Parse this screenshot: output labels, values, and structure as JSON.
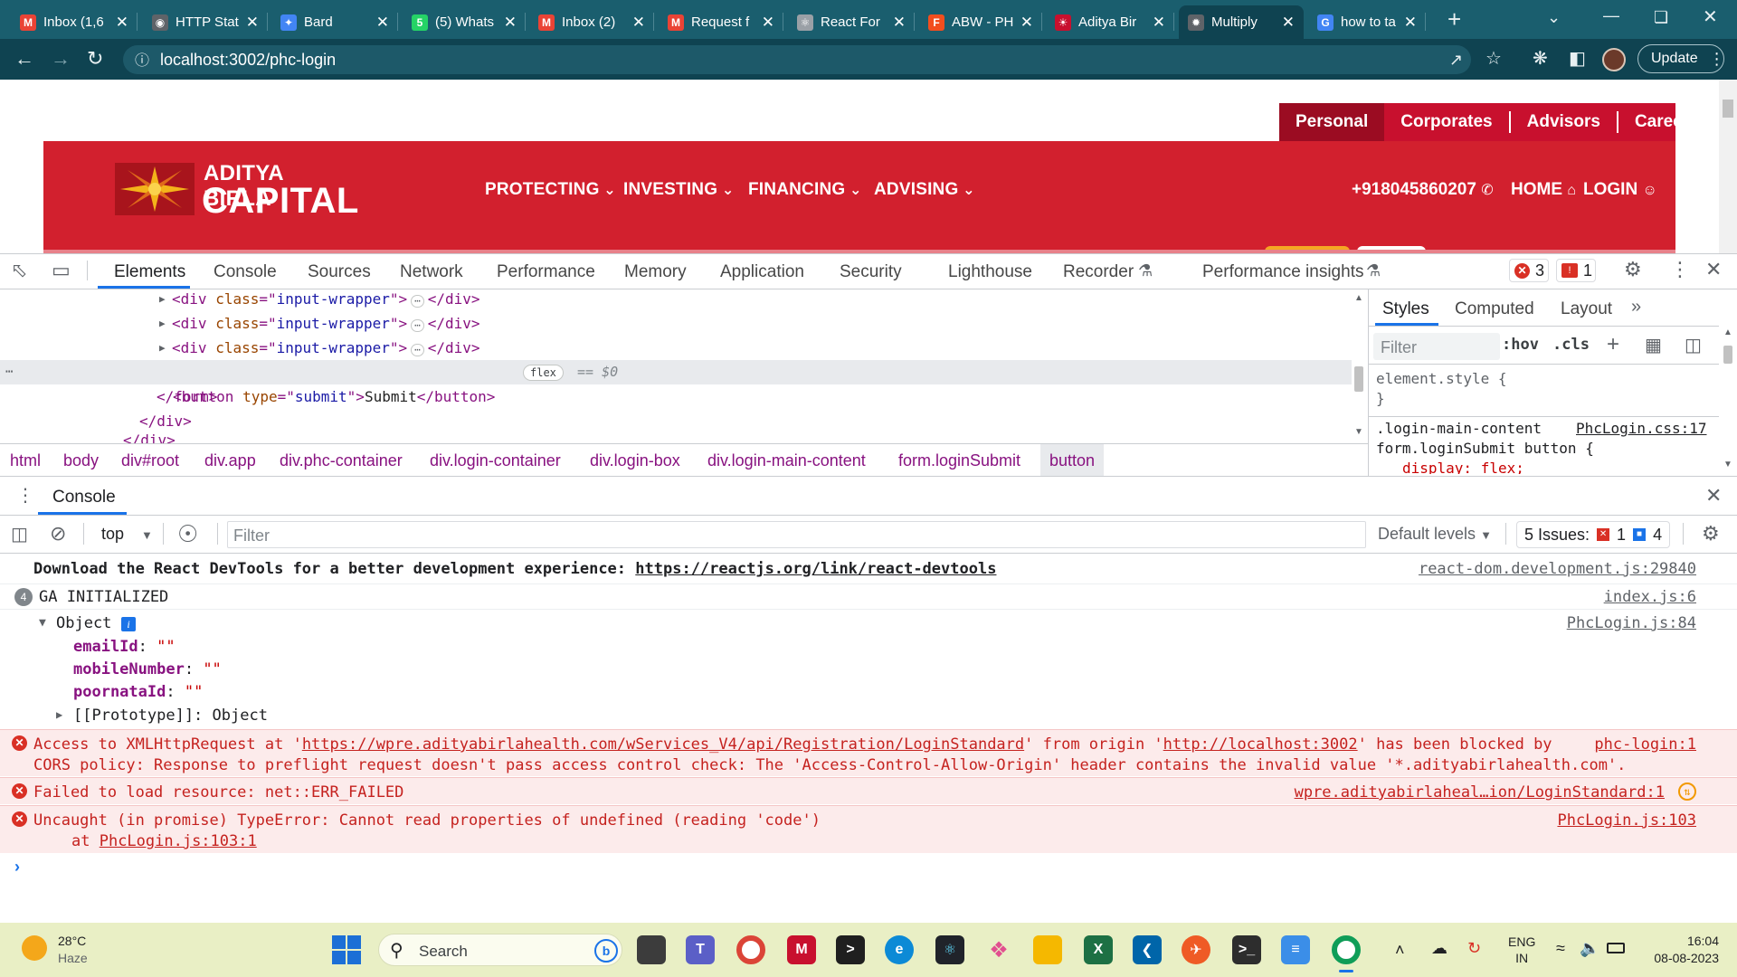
{
  "browser": {
    "tabs": [
      {
        "title": "Inbox (1,6",
        "icon": "gmail-icon"
      },
      {
        "title": "HTTP Stat",
        "icon": "globe-icon"
      },
      {
        "title": "Bard",
        "icon": "bard-icon"
      },
      {
        "title": "(5) Whats",
        "icon": "whatsapp-icon"
      },
      {
        "title": "Inbox (2)",
        "icon": "gmail-icon"
      },
      {
        "title": "Request f",
        "icon": "gmail-icon"
      },
      {
        "title": "React For",
        "icon": "react-icon"
      },
      {
        "title": "ABW - PH",
        "icon": "figma-icon"
      },
      {
        "title": "Aditya Bir",
        "icon": "aditya-birla-icon"
      },
      {
        "title": "Multiply",
        "icon": "openai-icon",
        "active": true
      },
      {
        "title": "how to ta",
        "icon": "google-icon"
      }
    ],
    "url": "localhost:3002/phc-login",
    "update_label": "Update"
  },
  "site": {
    "top_nav": [
      "Personal",
      "Corporates",
      "Advisors",
      "Careers"
    ],
    "logo_line1": "ADITYA BIRLA",
    "logo_line2": "CAPITAL",
    "main_nav": [
      "PROTECTING",
      "INVESTING",
      "FINANCING",
      "ADVISING"
    ],
    "phone": "+918045860207",
    "home": "HOME",
    "login": "LOGIN"
  },
  "devtools": {
    "tabs": [
      "Elements",
      "Console",
      "Sources",
      "Network",
      "Performance",
      "Memory",
      "Application",
      "Security",
      "Lighthouse",
      "Recorder",
      "Performance insights"
    ],
    "error_count": "3",
    "issue_count": "1",
    "elements": {
      "lines": [
        {
          "indent": 0,
          "tag": "div",
          "attr": "class",
          "val": "input-wrapper"
        },
        {
          "indent": 0,
          "tag": "div",
          "attr": "class",
          "val": "input-wrapper"
        },
        {
          "indent": 0,
          "tag": "div",
          "attr": "class",
          "val": "input-wrapper"
        }
      ],
      "selected_tag": "button",
      "selected_attr": "type",
      "selected_val": "submit",
      "selected_text": "Submit",
      "flex_badge": "flex",
      "dollar_zero": "== $0",
      "close_form": "</form>",
      "close_div": "</div>",
      "close_div2": "</div>"
    },
    "breadcrumbs": [
      "html",
      "body",
      "div#root",
      "div.app",
      "div.phc-container",
      "div.login-container",
      "div.login-box",
      "div.login-main-content",
      "form.loginSubmit",
      "button"
    ],
    "styles_tabs": [
      "Styles",
      "Computed",
      "Layout"
    ],
    "styles_filter": "Filter",
    "hov": ":hov",
    "cls": ".cls",
    "element_style": "element.style {",
    "brace_close": "}",
    "rule_selector1": ".login-main-content",
    "rule_source": "PhcLogin.css:17",
    "rule_selector2": "form.loginSubmit button {",
    "rule_prop": "display: flex;"
  },
  "console": {
    "drawer_title": "Console",
    "context": "top",
    "filter_placeholder": "Filter",
    "default_levels": "Default levels",
    "issues_label": "5 Issues:",
    "issues_err": "1",
    "issues_info": "4",
    "messages": [
      {
        "text": "Download the React DevTools for a better development experience: ",
        "link": "https://reactjs.org/link/react-devtools",
        "src": "react-dom.development.js:29840"
      },
      {
        "count": "4",
        "text": "GA INITIALIZED",
        "src": "index.js:6"
      },
      {
        "text": "Object",
        "src": "PhcLogin.js:84"
      }
    ],
    "object_props": [
      {
        "key": "emailId",
        "val": "\"\""
      },
      {
        "key": "mobileNumber",
        "val": "\"\""
      },
      {
        "key": "poornataId",
        "val": "\"\""
      }
    ],
    "prototype": "[[Prototype]]: Object",
    "errors": [
      {
        "line1_a": "Access to XMLHttpRequest at '",
        "line1_link": "https://wpre.adityabirlahealth.com/wServices_V4/api/Registration/LoginStandard",
        "line1_b": "' from origin '",
        "line1_origin": "http://localhost:3002",
        "line1_c": "' has been blocked by",
        "line2": "CORS policy: Response to preflight request doesn't pass access control check: The 'Access-Control-Allow-Origin' header contains the invalid value '*.adityabirlahealth.com'.",
        "src": "phc-login:1"
      },
      {
        "text": "Failed to load resource: net::ERR_FAILED",
        "src": "wpre.adityabirlaheal…ion/LoginStandard:1"
      },
      {
        "text": "Uncaught (in promise) TypeError: Cannot read properties of undefined (reading 'code')",
        "at": "at ",
        "at_link": "PhcLogin.js:103:1",
        "src": "PhcLogin.js:103"
      }
    ]
  },
  "taskbar": {
    "temp": "28°C",
    "weather": "Haze",
    "search": "Search",
    "lang1": "ENG",
    "lang2": "IN",
    "time": "16:04",
    "date": "08-08-2023"
  }
}
